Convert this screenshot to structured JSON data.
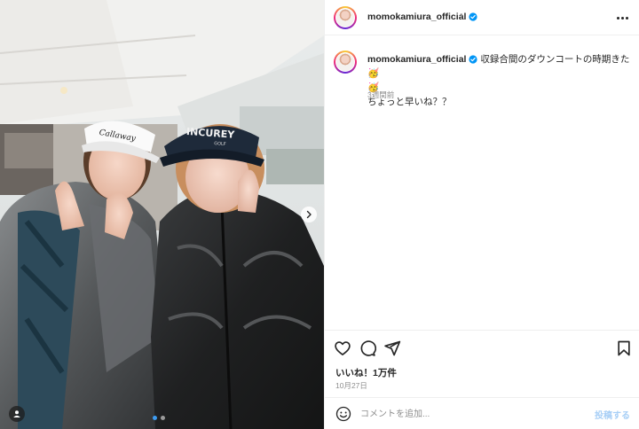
{
  "post": {
    "username": "momokamiura_official",
    "separator": "•",
    "caption_line1": "収録合間のダウンコートの時期きた🥳",
    "caption_line2": "🥳",
    "caption_line3": "ちょっと早いね？？",
    "time_ago": "3週間前"
  },
  "photo": {
    "visor_left_text": "Callaway",
    "visor_right_text": "INCUREY",
    "visor_right_sub": "GOLF"
  },
  "engagement": {
    "likes": "いいね！1万件",
    "date": "10月27日"
  },
  "comment": {
    "placeholder": "コメントを追加...",
    "post_label": "投稿する"
  },
  "colors": {
    "verified": "#0095f6",
    "post_button": "#a8cff6",
    "active_dot": "#3d9bf0"
  },
  "icons": [
    "more-icon",
    "heart-icon",
    "comment-icon",
    "share-icon",
    "bookmark-icon",
    "emoji-icon",
    "chevron-right-icon",
    "user-tag-icon",
    "verified-icon"
  ]
}
